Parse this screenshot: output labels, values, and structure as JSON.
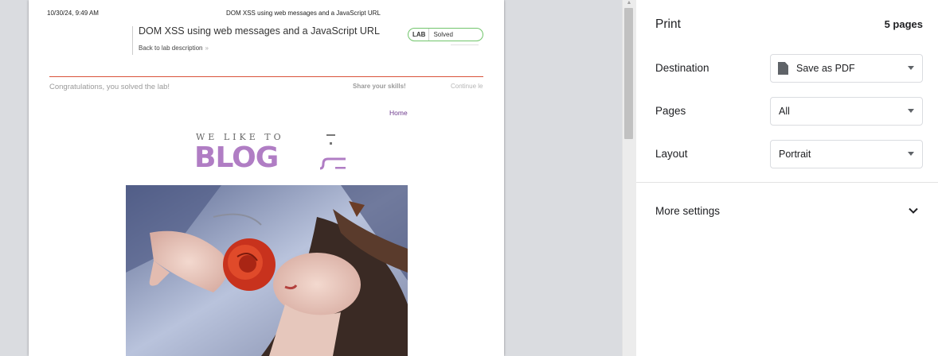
{
  "preview": {
    "header_date": "10/30/24, 9:49 AM",
    "header_title": "DOM XSS using web messages and a JavaScript URL",
    "lab_title": "DOM XSS using web messages and a JavaScript URL",
    "back_link": "Back to lab description",
    "badge_lab": "LAB",
    "badge_status": "Solved",
    "congrats": "Congratulations, you solved the lab!",
    "share": "Share your skills!",
    "continue": "Continue le",
    "home": "Home",
    "logo_tagline": "WE LIKE TO",
    "logo_word": "BLOG"
  },
  "sidebar": {
    "title": "Print",
    "page_count": "5 pages",
    "destination_label": "Destination",
    "destination_value": "Save as PDF",
    "pages_label": "Pages",
    "pages_value": "All",
    "layout_label": "Layout",
    "layout_value": "Portrait",
    "more_settings": "More settings"
  },
  "colors": {
    "accent_red": "#d9533a",
    "logo_purple": "#b07dc4",
    "solved_green": "#71c56b",
    "home_link": "#6e3b8e"
  },
  "icons": {
    "destination": "document-icon",
    "dropdown": "caret-down-icon",
    "expand": "chevron-down-icon",
    "back_arrow": "double-chevron-right-icon"
  }
}
